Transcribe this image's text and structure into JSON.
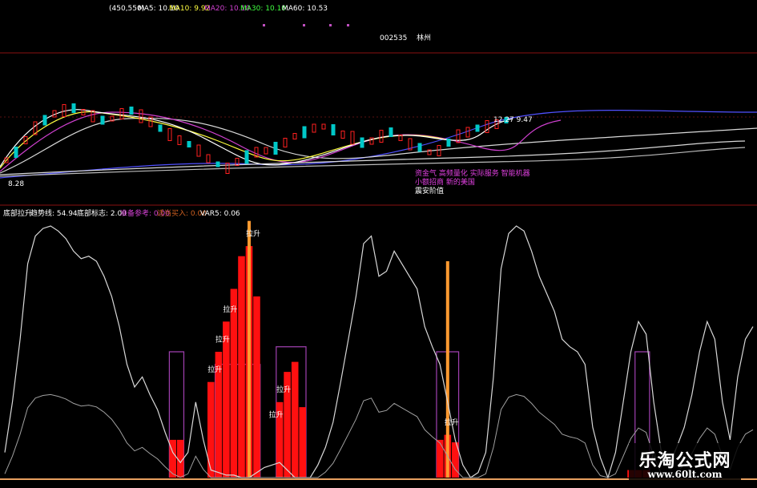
{
  "header": {
    "coord": "(450,550)",
    "ma5": "MA5: 10.10",
    "ma10": "MA10: 9.92",
    "ma20": "MA20: 10.10",
    "ma30": "MA30: 10.10",
    "ma60": "MA60: 10.53",
    "stock_code": "002535",
    "stock_name": "林州"
  },
  "price_panel": {
    "price_low_label": "8.28",
    "price_high_label": "12.27 9.47",
    "labels": [
      "资金气 高频量化 实际服务 智能机器",
      "小额招商 新的美国",
      "震安阶值"
    ]
  },
  "indicator_header": {
    "name": "底部拉升",
    "trend_label": "趋势线: 54.94",
    "bottom_flag": "底部标志: 2.00",
    "prepare": "准备参考: 0.00",
    "buy": "适当买入: 0.00",
    "var5": "VAR5: 0.06"
  },
  "signal_label": "拉升",
  "watermark": {
    "title": "乐淘公式网",
    "url": "www.60lt.com"
  },
  "colors": {
    "background": "#000000",
    "up": "#ff2020",
    "down": "#00c8c8",
    "ma5": "#ffffff",
    "ma10": "#ffff40",
    "ma20": "#d040d0",
    "ma30": "#40ff40",
    "ma60": "#5050ff",
    "trend": "#d8d8d8",
    "pulse": "#ff9a30",
    "box": "#a040b0",
    "bar": "#ff1010",
    "separator": "#8a1010"
  },
  "chart_data": {
    "type": "line",
    "trend_line": [
      0.1,
      0.3,
      0.55,
      0.85,
      0.96,
      0.99,
      1.0,
      0.98,
      0.95,
      0.9,
      0.87,
      0.88,
      0.86,
      0.8,
      0.72,
      0.6,
      0.45,
      0.36,
      0.4,
      0.33,
      0.27,
      0.18,
      0.1,
      0.06,
      0.1,
      0.3,
      0.15,
      0.03,
      0.02,
      0.01,
      0.01,
      0.0,
      0.0,
      0.02,
      0.04,
      0.05,
      0.06,
      0.03,
      0.0,
      0.0,
      0.0,
      0.05,
      0.12,
      0.22,
      0.38,
      0.55,
      0.72,
      0.93,
      0.96,
      0.8,
      0.82,
      0.9,
      0.85,
      0.8,
      0.75,
      0.6,
      0.52,
      0.45,
      0.3,
      0.15,
      0.05,
      0.0,
      0.02,
      0.1,
      0.4,
      0.83,
      0.97,
      1.0,
      0.98,
      0.9,
      0.8,
      0.73,
      0.66,
      0.55,
      0.52,
      0.5,
      0.45,
      0.2,
      0.08,
      0.0,
      0.1,
      0.3,
      0.5,
      0.62,
      0.57,
      0.3,
      0.1,
      0.05,
      0.12,
      0.2,
      0.33,
      0.5,
      0.62,
      0.55,
      0.3,
      0.15,
      0.4,
      0.55,
      0.6
    ],
    "bottom_bars": [
      0,
      0,
      0,
      0,
      0,
      0,
      0,
      0,
      0,
      0,
      0,
      0,
      0,
      0,
      0,
      0,
      0,
      0,
      0,
      0,
      0,
      0,
      0.15,
      0.15,
      0,
      0,
      0,
      0.38,
      0.5,
      0.62,
      0.75,
      0.88,
      0.92,
      0.72,
      0,
      0,
      0.3,
      0.42,
      0.46,
      0.28,
      0,
      0,
      0,
      0,
      0,
      0,
      0,
      0,
      0,
      0,
      0,
      0,
      0,
      0,
      0,
      0,
      0,
      0.15,
      0.17,
      0.14,
      0,
      0,
      0,
      0,
      0,
      0,
      0,
      0,
      0,
      0,
      0,
      0,
      0,
      0,
      0,
      0,
      0,
      0,
      0,
      0,
      0,
      0,
      0.03,
      0.03,
      0.03,
      0,
      0,
      0,
      0,
      0,
      0,
      0,
      0,
      0,
      0,
      0,
      0,
      0,
      0
    ],
    "signal_markers": [
      "32",
      "29",
      "28",
      "27",
      "35",
      "36",
      "58",
      "84"
    ],
    "ylim": [
      0,
      1
    ]
  }
}
